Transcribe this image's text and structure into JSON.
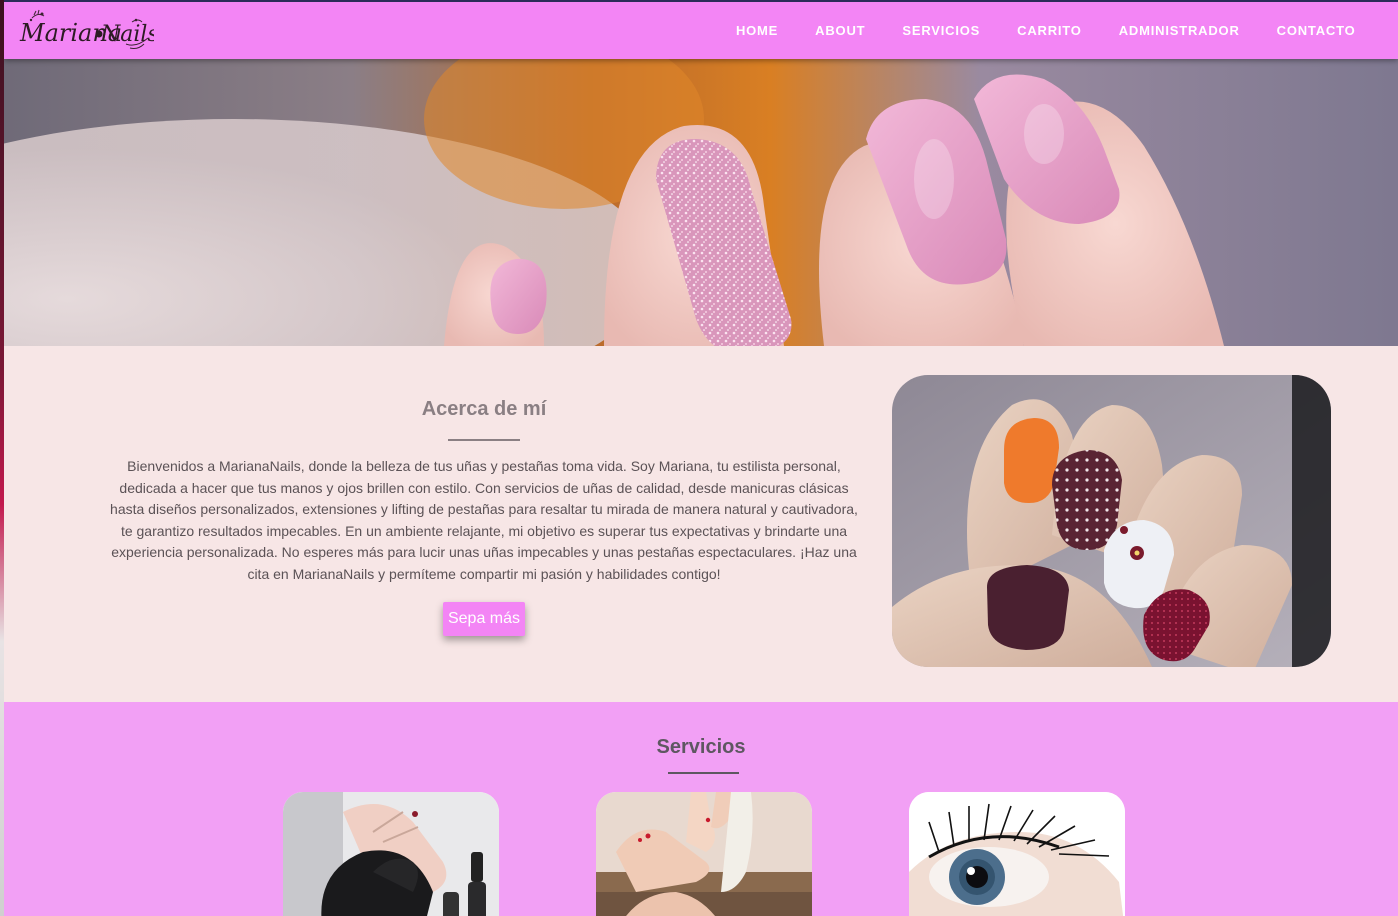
{
  "brand": {
    "logo_text": "MarianaNails",
    "primary_color": "#f385f5",
    "services_bg": "#f2a0f5",
    "about_bg": "#f7e6e6"
  },
  "nav": {
    "items": [
      {
        "label": "HOME"
      },
      {
        "label": "ABOUT"
      },
      {
        "label": "SERVICIOS"
      },
      {
        "label": "CARRITO"
      },
      {
        "label": "ADMINISTRADOR"
      },
      {
        "label": "CONTACTO"
      }
    ]
  },
  "about": {
    "title": "Acerca de mí",
    "text": "Bienvenidos a MarianaNails, donde la belleza de tus uñas y pestañas toma vida. Soy Mariana, tu estilista personal, dedicada a hacer que tus manos y ojos brillen con estilo. Con servicios de uñas de calidad, desde manicuras clásicas hasta diseños personalizados, extensiones y lifting de pestañas para resaltar tu mirada de manera natural y cautivadora, te garantizo resultados impecables. En un ambiente relajante, mi objetivo es superar tus expectativas y brindarte una experiencia personalizada. No esperes más para lucir unas uñas impecables y unas pestañas espectaculares. ¡Haz una cita en MarianaNails y permíteme compartir mi pasión y habilidades contigo!",
    "button_label": "Sepa más"
  },
  "services": {
    "title": "Servicios"
  }
}
